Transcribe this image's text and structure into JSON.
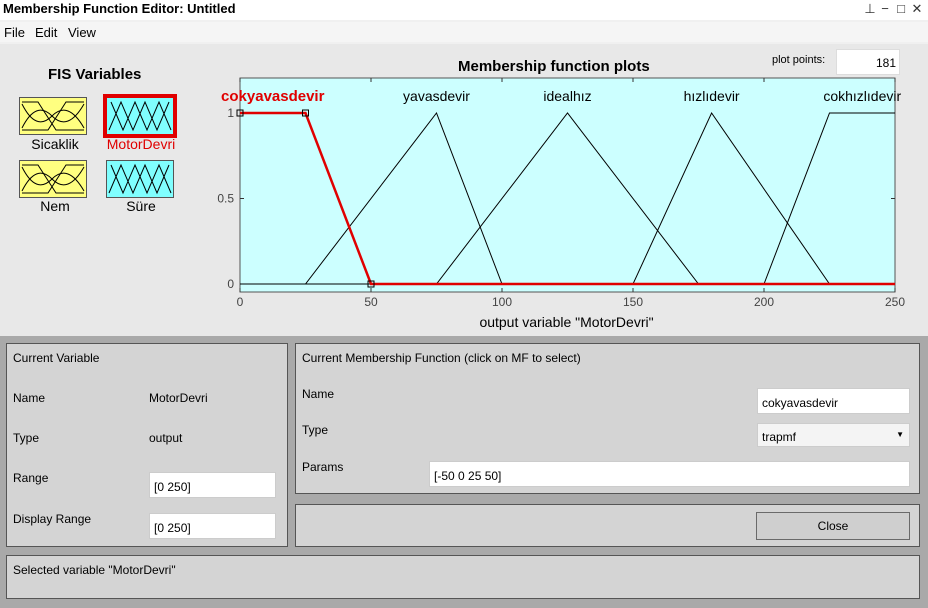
{
  "window": {
    "title": "Membership Function Editor: Untitled",
    "menu": [
      "File",
      "Edit",
      "View"
    ]
  },
  "fis_variables": {
    "heading": "FIS Variables",
    "items": [
      {
        "label": "Sicaklik",
        "kind": "input",
        "selected": false
      },
      {
        "label": "MotorDevri",
        "kind": "output",
        "selected": true
      },
      {
        "label": "Nem",
        "kind": "input",
        "selected": false
      },
      {
        "label": "Süre",
        "kind": "output",
        "selected": false
      }
    ]
  },
  "plot": {
    "title": "Membership function plots",
    "plot_points_label": "plot points:",
    "plot_points_value": "181"
  },
  "chart_data": {
    "type": "line",
    "xlabel": "output variable \"MotorDevri\"",
    "xlim": [
      0,
      250
    ],
    "ylim": [
      0,
      1
    ],
    "xticks": [
      0,
      50,
      100,
      150,
      200,
      250
    ],
    "yticks": [
      0,
      0.5,
      1
    ],
    "background": "#ccffff",
    "selected_color": "#e00000",
    "series": [
      {
        "name": "cokyavasdevir",
        "mf": "trapmf",
        "points": [
          [
            0,
            1
          ],
          [
            25,
            1
          ],
          [
            50,
            0
          ],
          [
            250,
            0
          ]
        ],
        "selected": true
      },
      {
        "name": "yavasdevir",
        "mf": "trimf",
        "points": [
          [
            0,
            0
          ],
          [
            25,
            0
          ],
          [
            75,
            1
          ],
          [
            100,
            0
          ],
          [
            250,
            0
          ]
        ],
        "selected": false
      },
      {
        "name": "idealhız",
        "mf": "trimf",
        "points": [
          [
            0,
            0
          ],
          [
            75,
            0
          ],
          [
            125,
            1
          ],
          [
            175,
            0
          ],
          [
            250,
            0
          ]
        ],
        "selected": false
      },
      {
        "name": "hızlıdevir",
        "mf": "trimf",
        "points": [
          [
            0,
            0
          ],
          [
            150,
            0
          ],
          [
            180,
            1
          ],
          [
            225,
            0
          ],
          [
            250,
            0
          ]
        ],
        "selected": false
      },
      {
        "name": "cokhızlıdevir",
        "mf": "trapmf",
        "points": [
          [
            0,
            0
          ],
          [
            200,
            0
          ],
          [
            225,
            1
          ],
          [
            250,
            1
          ]
        ],
        "selected": false
      }
    ]
  },
  "current_variable": {
    "heading": "Current Variable",
    "name_label": "Name",
    "name_value": "MotorDevri",
    "type_label": "Type",
    "type_value": "output",
    "range_label": "Range",
    "range_value": "[0 250]",
    "display_range_label": "Display Range",
    "display_range_value": "[0 250]"
  },
  "current_mf": {
    "heading": "Current Membership Function (click on MF to select)",
    "name_label": "Name",
    "name_value": "cokyavasdevir",
    "type_label": "Type",
    "type_value": "trapmf",
    "params_label": "Params",
    "params_value": "[-50 0 25 50]"
  },
  "close_label": "Close",
  "status": "Selected variable \"MotorDevri\""
}
